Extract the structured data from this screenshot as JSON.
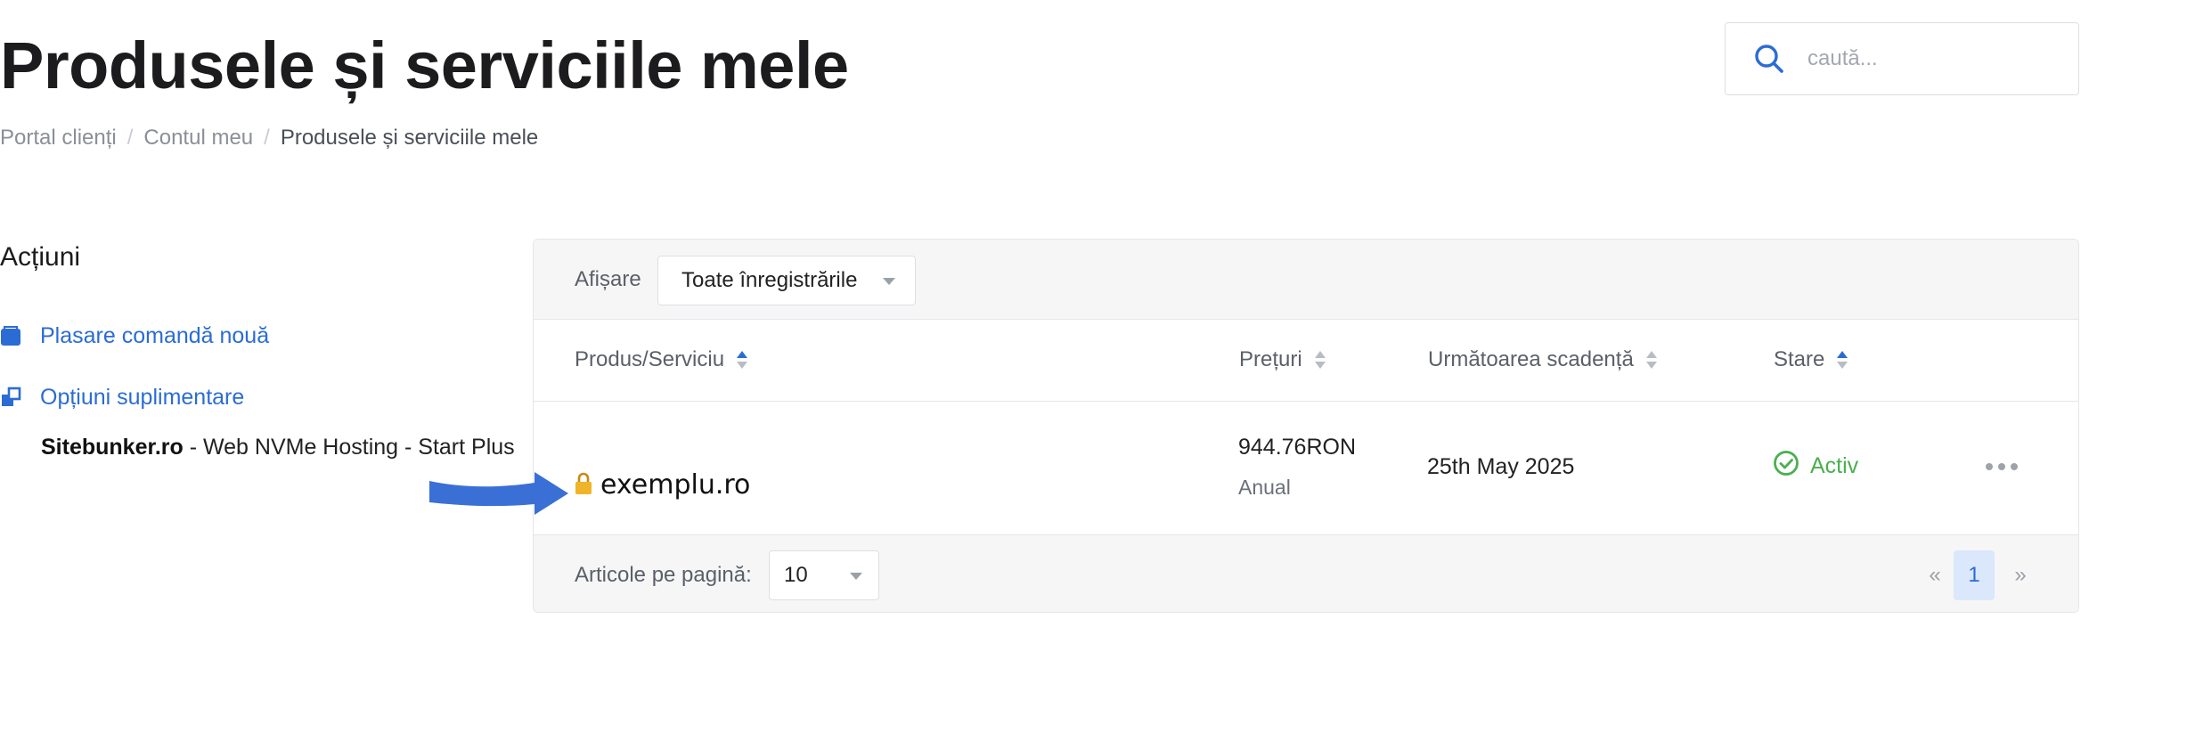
{
  "page": {
    "title": "Produsele și serviciile mele"
  },
  "breadcrumb": {
    "items": [
      "Portal clienți",
      "Contul meu",
      "Produsele și serviciile mele"
    ],
    "separator": "/"
  },
  "search": {
    "placeholder": "caută...",
    "value": ""
  },
  "sidebar": {
    "title": "Acțiuni",
    "items": [
      {
        "label": "Plasare comandă nouă",
        "icon": "cart-icon"
      },
      {
        "label": "Opțiuni suplimentare",
        "icon": "addons-icon"
      }
    ]
  },
  "table": {
    "filter_label": "Afișare",
    "filter_value": "Toate înregistrările",
    "columns": [
      {
        "label": "Produs/Serviciu",
        "sorted": "asc"
      },
      {
        "label": "Prețuri",
        "sorted": "none"
      },
      {
        "label": "Următoarea scadență",
        "sorted": "none"
      },
      {
        "label": "Stare",
        "sorted": "asc"
      }
    ],
    "rows": [
      {
        "product_brand": "Sitebunker.ro",
        "product_name": "- Web NVMe Hosting - Start Plus",
        "domain": "exemplu.ro",
        "price": "944.76RON",
        "billing_cycle": "Anual",
        "next_due": "25th May 2025",
        "status": "Activ"
      }
    ],
    "per_page_label": "Articole pe pagină:",
    "per_page_value": "10",
    "pagination": {
      "prev": "«",
      "current": "1",
      "next": "»"
    }
  },
  "colors": {
    "accent": "#2b6cd4",
    "status_active": "#4caf50",
    "annotation_arrow": "#3a6fd6",
    "lock": "#f0b429"
  }
}
